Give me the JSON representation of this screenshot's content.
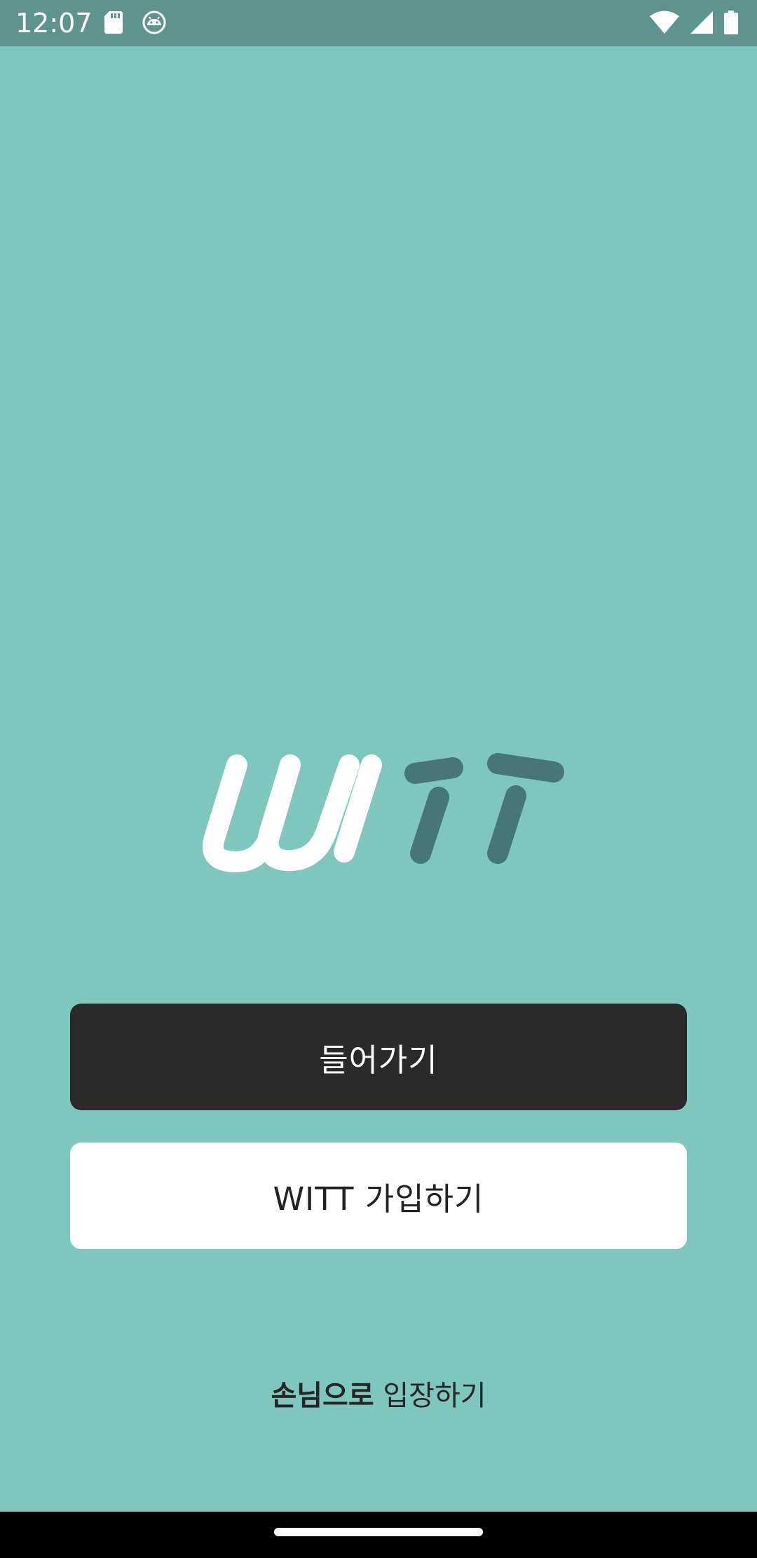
{
  "status_bar": {
    "time": "12:07",
    "left_icons": [
      "sd-card-icon",
      "android-debug-icon"
    ],
    "right_icons": [
      "wifi-icon",
      "cellular-signal-icon",
      "battery-icon"
    ]
  },
  "logo": {
    "text": "WITT",
    "colors": {
      "primary": "#ffffff",
      "secondary": "#467777"
    }
  },
  "actions": {
    "enter_label": "들어가기",
    "signup_label": "WITT 가입하기"
  },
  "guest": {
    "bold_text": "손님으로",
    "rest_text": " 입장하기"
  },
  "colors": {
    "background": "#7fc7bc",
    "status_bar": "#5f948e",
    "enter_button": "#2a2a2b",
    "signup_button": "#ffffff"
  }
}
